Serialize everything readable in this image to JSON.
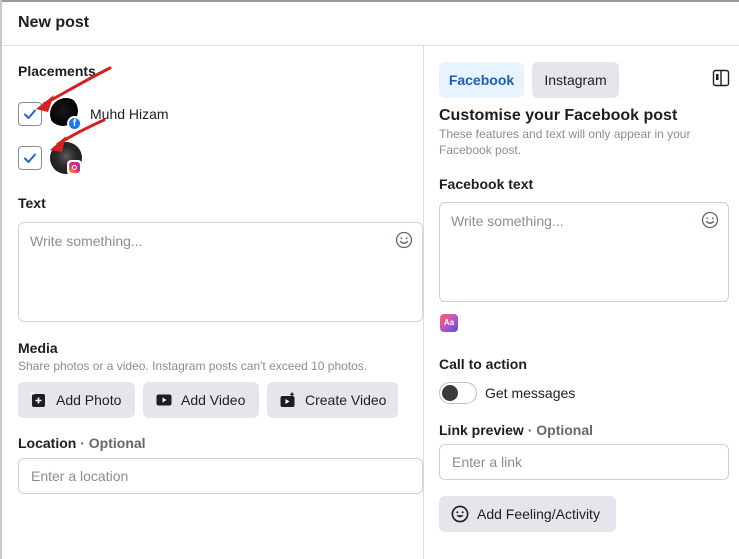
{
  "dialog": {
    "title": "New post"
  },
  "placements": {
    "label": "Placements",
    "accounts": [
      {
        "name": "Muhd Hizam",
        "platform": "facebook",
        "checked": true
      },
      {
        "name": "",
        "platform": "instagram",
        "checked": true
      }
    ]
  },
  "text_section": {
    "label": "Text",
    "placeholder": "Write something..."
  },
  "media": {
    "label": "Media",
    "hint": "Share photos or a video. Instagram posts can't exceed 10 photos.",
    "buttons": {
      "add_photo": "Add Photo",
      "add_video": "Add Video",
      "create_video": "Create Video"
    }
  },
  "location": {
    "label": "Location",
    "optional": "· Optional",
    "placeholder": "Enter a location"
  },
  "tabs": {
    "facebook": "Facebook",
    "instagram": "Instagram",
    "active": "facebook"
  },
  "customise": {
    "title": "Customise your Facebook post",
    "description": "These features and text will only appear in your Facebook post."
  },
  "facebook_text": {
    "label": "Facebook text",
    "placeholder": "Write something..."
  },
  "call_to_action": {
    "label": "Call to action",
    "toggle_label": "Get messages",
    "enabled": false
  },
  "link_preview": {
    "label": "Link preview",
    "optional": "· Optional",
    "placeholder": "Enter a link"
  },
  "feeling": {
    "label": "Add Feeling/Activity"
  },
  "colors": {
    "accent": "#1877f2",
    "arrow": "#d42020",
    "tab_active_bg": "#e7f3ff",
    "button_bg": "#e4e6eb"
  },
  "icons": [
    "check-icon",
    "facebook-badge-icon",
    "instagram-badge-icon",
    "emoji-icon",
    "add-photo-icon",
    "add-video-icon",
    "create-video-icon",
    "panel-toggle-icon",
    "text-style-icon",
    "smiley-icon"
  ]
}
